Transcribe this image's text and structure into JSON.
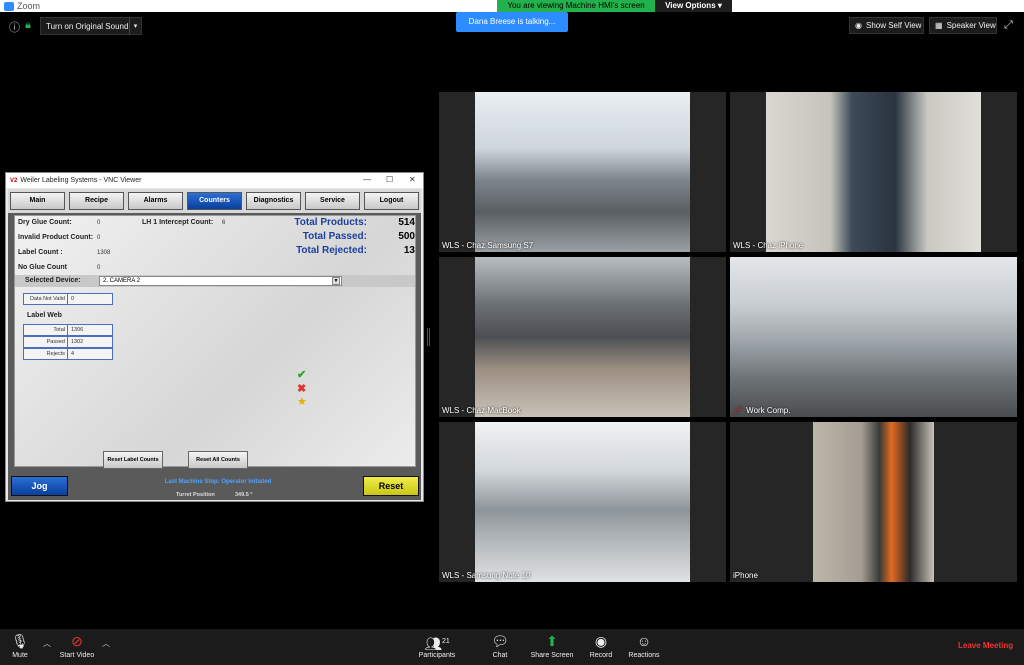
{
  "app": {
    "title": "Zoom",
    "viewing_banner": "You are viewing Machine HMI's screen",
    "view_options": "View Options",
    "talking": "Dana Breese is talking...",
    "original_sound": "Turn on Original Sound",
    "show_self_view": "Show Self View",
    "speaker_view": "Speaker View"
  },
  "vnc": {
    "title": "Weiler Labeling Systems - VNC Viewer",
    "tabs": [
      "Main",
      "Recipe",
      "Alarms",
      "Counters",
      "Diagnostics",
      "Service",
      "Logout"
    ],
    "active_tab": "Counters",
    "counts": {
      "dry_glue_label": "Dry Glue Count:",
      "dry_glue_value": "0",
      "lh1_label": "LH 1 Intercept Count:",
      "lh1_value": "6",
      "invalid_label": "Invalid Product Count:",
      "invalid_value": "0",
      "label_count_label": "Label Count :",
      "label_count_value": "1308",
      "no_glue_label": "No Glue Count",
      "no_glue_value": "0"
    },
    "totals": {
      "products_label": "Total Products:",
      "products_value": "514",
      "passed_label": "Total Passed:",
      "passed_value": "500",
      "rejected_label": "Total Rejected:",
      "rejected_value": "13"
    },
    "selected_device_label": "Selected Device:",
    "selected_device": "2. CAMERA 2",
    "data_not_valid_label": "Data Not Valid",
    "data_not_valid_value": "0",
    "label_web": "Label Web",
    "web_stats": [
      {
        "label": "Total",
        "value": "1306"
      },
      {
        "label": "Passed",
        "value": "1302"
      },
      {
        "label": "Rejects",
        "value": "4"
      }
    ],
    "reset_label_counts": "Reset Label Counts",
    "reset_all_counts": "Reset All Counts",
    "jog": "Jog",
    "reset": "Reset",
    "last_stop": "Last Machine Stop: Operator Initiated",
    "turret_label": "Turret Position",
    "turret_value": "349.5 °"
  },
  "tiles": [
    {
      "name": "WLS - Chaz Samsung S7",
      "muted": false
    },
    {
      "name": "WLS - Chaz iPhone",
      "muted": false
    },
    {
      "name": "WLS - Chaz MacBook",
      "muted": false
    },
    {
      "name": "Work Comp.",
      "muted": true
    },
    {
      "name": "WLS - Samsung Note 10",
      "muted": false
    },
    {
      "name": "iPhone",
      "muted": false
    }
  ],
  "toolbar": {
    "mute": "Mute",
    "start_video": "Start Video",
    "participants": "Participants",
    "participants_count": "21",
    "chat": "Chat",
    "share_screen": "Share Screen",
    "record": "Record",
    "reactions": "Reactions",
    "leave": "Leave Meeting"
  }
}
